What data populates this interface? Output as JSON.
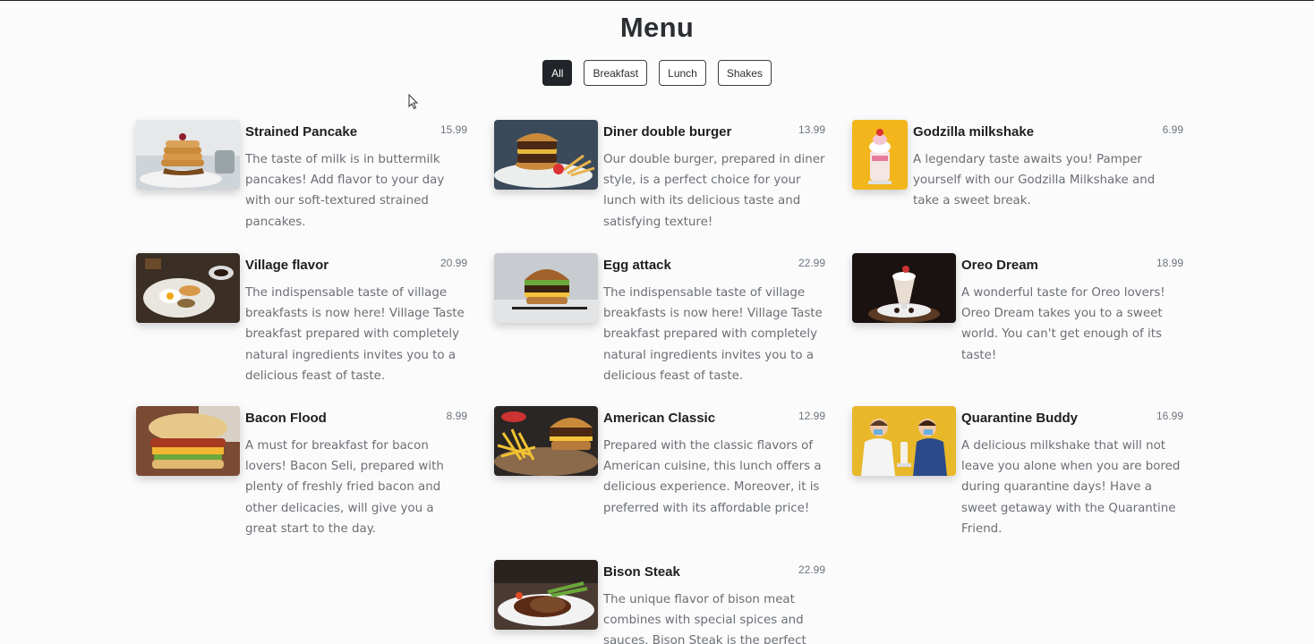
{
  "page": {
    "title": "Menu"
  },
  "filters": [
    {
      "label": "All",
      "active": true
    },
    {
      "label": "Breakfast",
      "active": false
    },
    {
      "label": "Lunch",
      "active": false
    },
    {
      "label": "Shakes",
      "active": false
    }
  ],
  "items": [
    {
      "name": "Strained Pancake",
      "price": "15.99",
      "desc": "The taste of milk is in buttermilk pancakes! Add flavor to your day with our soft-textured strained pancakes."
    },
    {
      "name": "Diner double burger",
      "price": "13.99",
      "desc": "Our double burger, prepared in diner style, is a perfect choice for your lunch with its delicious taste and satisfying texture!"
    },
    {
      "name": "Godzilla milkshake",
      "price": "6.99",
      "desc": "A legendary taste awaits you! Pamper yourself with our Godzilla Milkshake and take a sweet break."
    },
    {
      "name": "Village flavor",
      "price": "20.99",
      "desc": "The indispensable taste of village breakfasts is now here! Village Taste breakfast prepared with completely natural ingredients invites you to a delicious feast of taste."
    },
    {
      "name": "Egg attack",
      "price": "22.99",
      "desc": "The indispensable taste of village breakfasts is now here! Village Taste breakfast prepared with completely natural ingredients invites you to a delicious feast of taste."
    },
    {
      "name": "Oreo Dream",
      "price": "18.99",
      "desc": "A wonderful taste for Oreo lovers! Oreo Dream takes you to a sweet world. You can't get enough of its taste!"
    },
    {
      "name": "Bacon Flood",
      "price": "8.99",
      "desc": "A must for breakfast for bacon lovers! Bacon Seli, prepared with plenty of freshly fried bacon and other delicacies, will give you a great start to the day."
    },
    {
      "name": "American Classic",
      "price": "12.99",
      "desc": "Prepared with the classic flavors of American cuisine, this lunch offers a delicious experience. Moreover, it is preferred with its affordable price!"
    },
    {
      "name": "Quarantine Buddy",
      "price": "16.99",
      "desc": "A delicious milkshake that will not leave you alone when you are bored during quarantine days! Have a sweet getaway with the Quarantine Friend."
    },
    {
      "name": "Bison Steak",
      "price": "22.99",
      "desc": "The unique flavor of bison meat combines with special spices and sauces. Bison Steak is the perfect"
    }
  ]
}
